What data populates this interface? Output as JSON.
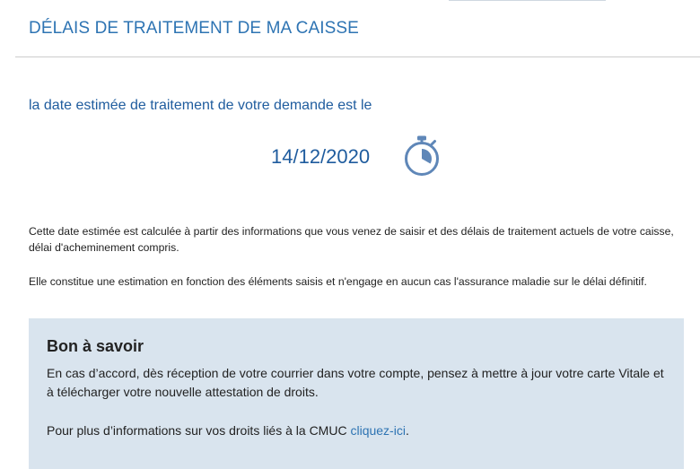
{
  "header": {
    "title": "DÉLAIS DE TRAITEMENT DE MA CAISSE"
  },
  "estimate": {
    "label": "la date estimée de traitement de votre demande est le",
    "date": "14/12/2020",
    "icon": "stopwatch-icon"
  },
  "info": {
    "paragraph_1": "Cette date estimée est calculée à partir des informations que vous venez de saisir et des délais de traitement actuels de votre caisse, délai d'acheminement compris.",
    "paragraph_2": "Elle constitue une estimation en fonction des éléments saisis et n'engage en aucun cas l'assurance maladie sur le délai définitif."
  },
  "notice": {
    "title": "Bon à savoir",
    "text_1": "En cas d’accord, dès réception de votre courrier dans votre compte, pensez à mettre à jour votre carte Vitale et à télécharger votre nouvelle attestation de droits.",
    "text_2_prefix": "Pour plus d’informations sur vos droits liés à la CMUC ",
    "link_label": "cliquez-ici",
    "text_2_suffix": "."
  },
  "colors": {
    "title_blue": "#2e74b3",
    "text_blue": "#1f5c9e",
    "icon_blue": "#5f87b8",
    "notice_background": "#d9e4ee"
  }
}
